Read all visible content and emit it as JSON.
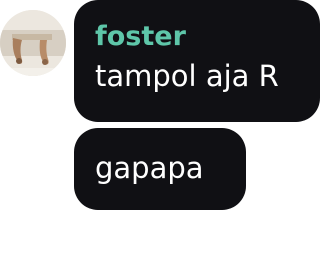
{
  "chat": {
    "avatar_icon": "user-avatar-photo",
    "sender_color": "#5ec6a9",
    "bubble_color": "#101014",
    "messages": [
      {
        "sender": "foster",
        "text": "tampol aja R"
      },
      {
        "text": "gapapa"
      }
    ]
  }
}
